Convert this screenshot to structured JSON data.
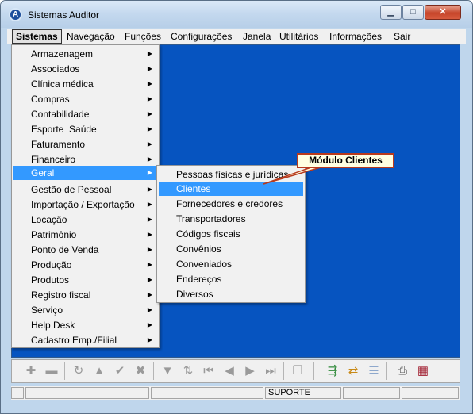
{
  "window": {
    "title": "Sistemas Auditor",
    "icon": "auditor-logo"
  },
  "menubar": {
    "items": [
      "Sistemas",
      "Navegação",
      "Funções",
      "Configurações",
      "Janela",
      "Utilitários",
      "Informações",
      "Sair"
    ],
    "active": "Sistemas"
  },
  "sistemas_menu": {
    "items": [
      "Armazenagem",
      "Associados",
      "Clínica médica",
      "Compras",
      "Contabilidade",
      "Esporte  Saúde",
      "Faturamento",
      "Financeiro",
      "Geral",
      "Gestão de Pessoal",
      "Importação / Exportação",
      "Locação",
      "Patrimônio",
      "Ponto de Venda",
      "Produção",
      "Produtos",
      "Registro fiscal",
      "Serviço",
      "Help Desk",
      "Cadastro Emp./Filial"
    ],
    "highlighted": "Geral"
  },
  "geral_submenu": {
    "items": [
      "Pessoas físicas e jurídicas",
      "Clientes",
      "Fornecedores e credores",
      "Transportadores",
      "Códigos fiscais",
      "Convênios",
      "Conveniados",
      "Endereços",
      "Diversos"
    ],
    "highlighted": "Clientes"
  },
  "callout": {
    "text": "Módulo Clientes"
  },
  "statusbar": {
    "panels": [
      "",
      "",
      "",
      "SUPORTE",
      "",
      ""
    ]
  },
  "colors": {
    "desktop": "#0654c0",
    "highlight": "#3399ff",
    "callout_border": "#b83a1d",
    "callout_bg": "#ffffe1"
  },
  "toolbar": {
    "icons": [
      "add-icon",
      "remove-icon",
      "refresh-icon",
      "up-icon",
      "confirm-icon",
      "cancel-icon",
      "filter-icon",
      "sort-icon",
      "first-icon",
      "prev-icon",
      "next-icon",
      "last-icon",
      "copy-icon",
      "export-icon",
      "import-icon",
      "list-icon",
      "print-icon",
      "calendar-icon"
    ]
  }
}
